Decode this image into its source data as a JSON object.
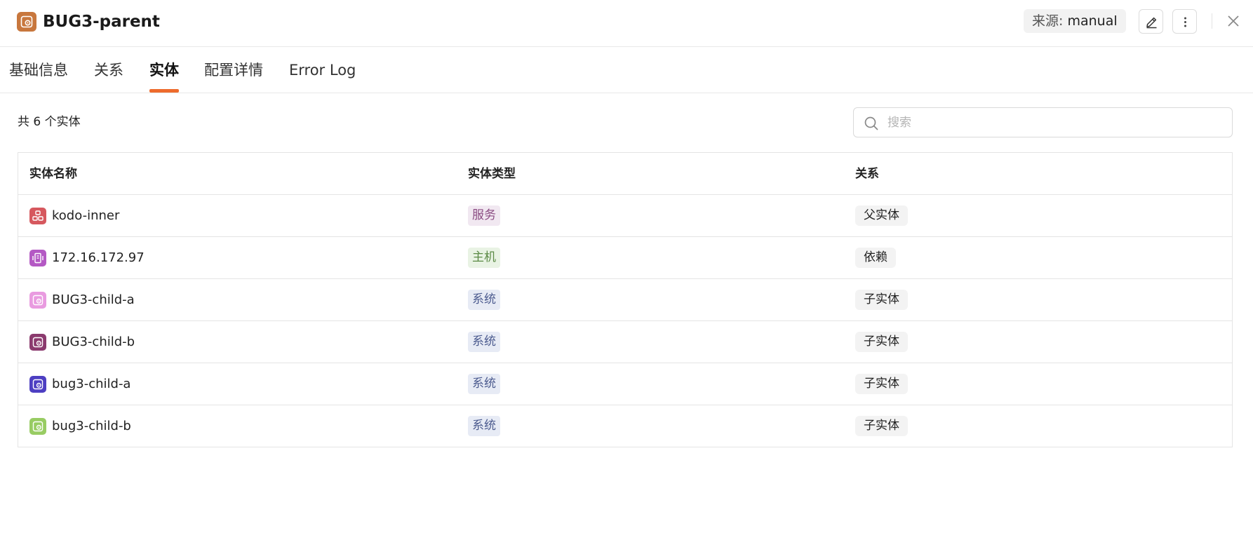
{
  "header": {
    "title": "BUG3-parent",
    "source_label": "来源:",
    "source_value": "manual",
    "title_icon": "system-icon",
    "title_icon_color": "#c8773d"
  },
  "tabs": [
    {
      "label": "基础信息",
      "active": false
    },
    {
      "label": "关系",
      "active": false
    },
    {
      "label": "实体",
      "active": true
    },
    {
      "label": "配置详情",
      "active": false
    },
    {
      "label": "Error Log",
      "active": false
    }
  ],
  "accent_color": "#ee6b2d",
  "entity_count_text": "共 6 个实体",
  "search": {
    "placeholder": "搜索",
    "value": ""
  },
  "table": {
    "columns": [
      "实体名称",
      "实体类型",
      "关系"
    ],
    "rows": [
      {
        "name": "kodo-inner",
        "icon": "service-icon",
        "icon_color": "#d6585e",
        "type": "服务",
        "type_bg": "#f1e8f1",
        "type_color": "#8a4b82",
        "relation": "父实体"
      },
      {
        "name": "172.16.172.97",
        "icon": "host-icon",
        "icon_color": "#b459c4",
        "type": "主机",
        "type_bg": "#e9f3e4",
        "type_color": "#5b8a45",
        "relation": "依赖"
      },
      {
        "name": "BUG3-child-a",
        "icon": "system-icon",
        "icon_color": "#e99be0",
        "type": "系统",
        "type_bg": "#e7ebf5",
        "type_color": "#4c5b8f",
        "relation": "子实体"
      },
      {
        "name": "BUG3-child-b",
        "icon": "system-icon",
        "icon_color": "#8b3a6e",
        "type": "系统",
        "type_bg": "#e7ebf5",
        "type_color": "#4c5b8f",
        "relation": "子实体"
      },
      {
        "name": "bug3-child-a",
        "icon": "system-icon",
        "icon_color": "#4d3fc2",
        "type": "系统",
        "type_bg": "#e7ebf5",
        "type_color": "#4c5b8f",
        "relation": "子实体"
      },
      {
        "name": "bug3-child-b",
        "icon": "system-icon",
        "icon_color": "#98cc63",
        "type": "系统",
        "type_bg": "#e7ebf5",
        "type_color": "#4c5b8f",
        "relation": "子实体"
      }
    ]
  }
}
